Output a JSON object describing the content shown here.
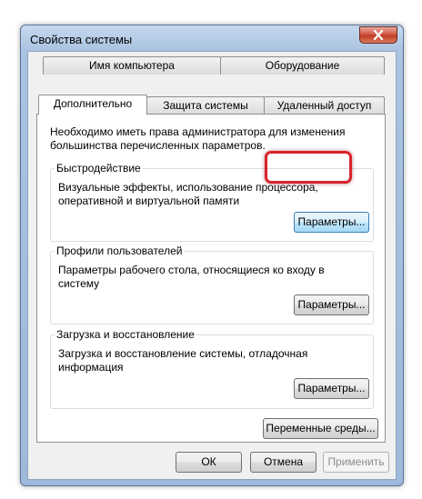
{
  "window": {
    "title": "Свойства системы"
  },
  "tabs_top": [
    "Имя компьютера",
    "Оборудование"
  ],
  "tabs_bottom": [
    "Дополнительно",
    "Защита системы",
    "Удаленный доступ"
  ],
  "intro_text": "Необходимо иметь права администратора для изменения большинства перечисленных параметров.",
  "performance": {
    "legend": "Быстродействие",
    "text": "Визуальные эффекты, использование процессора, оперативной и виртуальной памяти",
    "button": "Параметры..."
  },
  "profiles": {
    "legend": "Профили пользователей",
    "text": "Параметры рабочего стола, относящиеся ко входу в систему",
    "button": "Параметры..."
  },
  "startup": {
    "legend": "Загрузка и восстановление",
    "text": "Загрузка и восстановление системы, отладочная информация",
    "button": "Параметры..."
  },
  "env_button": "Переменные среды...",
  "footer": {
    "ok": "ОК",
    "cancel": "Отмена",
    "apply": "Применить"
  },
  "colors": {
    "highlight": "#d9232c",
    "close_button": "#c03a22"
  }
}
